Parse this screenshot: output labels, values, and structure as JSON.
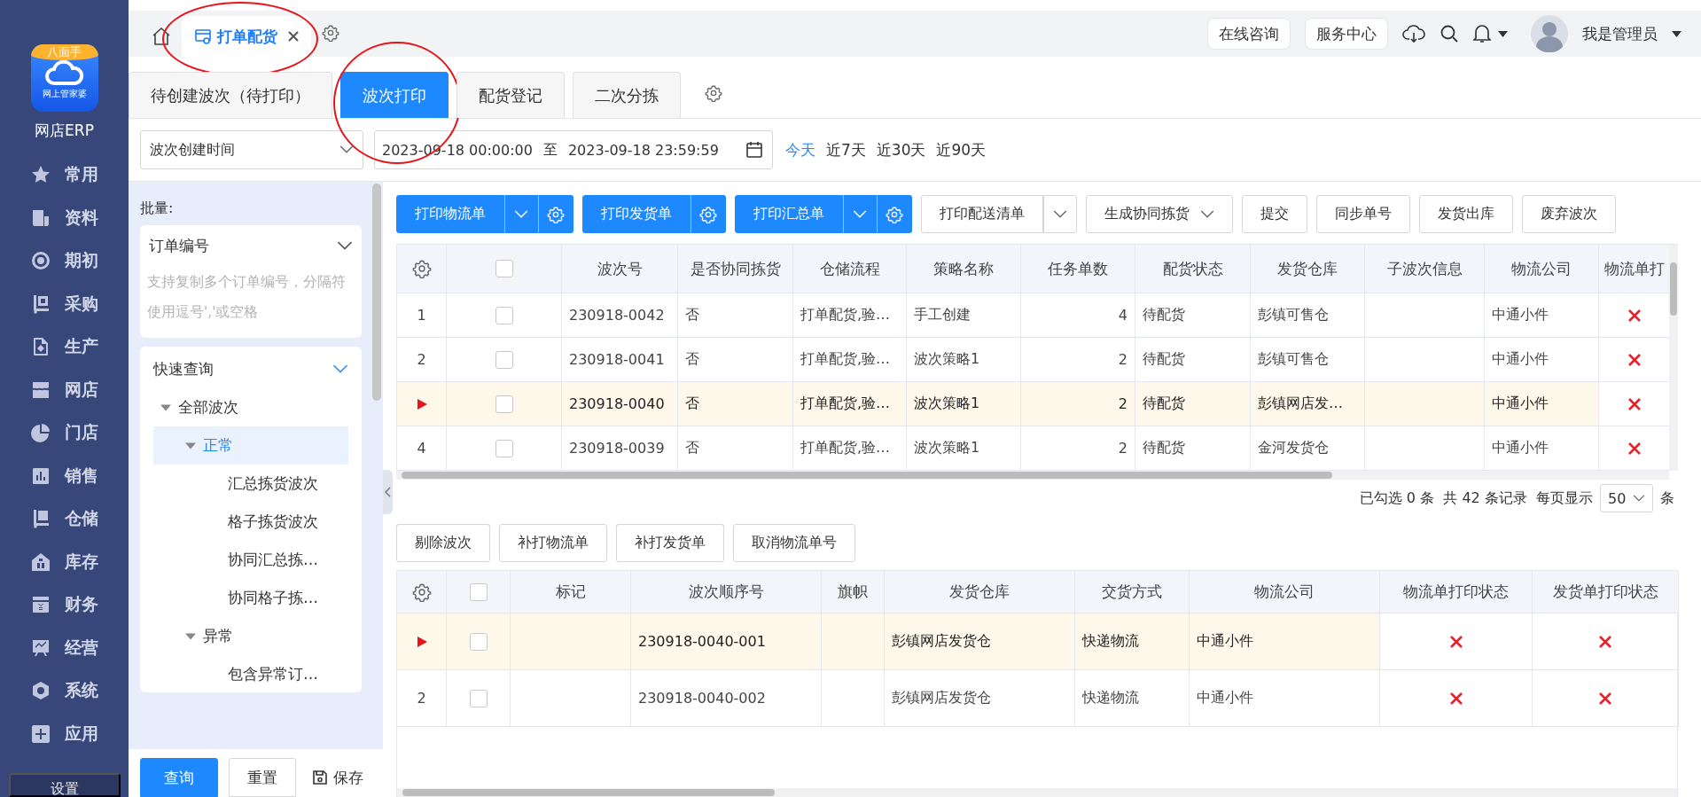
{
  "sidebar": {
    "logo_badge": "八面手",
    "logo_caption": "网上管家婆",
    "brand": "网店ERP",
    "items": [
      "常用",
      "资料",
      "期初",
      "采购",
      "生产",
      "网店",
      "门店",
      "销售",
      "仓储",
      "库存",
      "财务",
      "经营",
      "系统",
      "应用"
    ],
    "footer": "设置"
  },
  "page_tabs": [
    {
      "label": "打单配货",
      "selected": true,
      "circled": true
    }
  ],
  "header_links": [
    "在线咨询",
    "服务中心"
  ],
  "user": {
    "name": "我是管理员"
  },
  "sub_tabs": [
    {
      "label": "待创建波次（待打印）",
      "selected": false,
      "circled": false
    },
    {
      "label": "波次打印",
      "selected": true,
      "circled": true
    },
    {
      "label": "配货登记",
      "selected": false,
      "circled": false
    },
    {
      "label": "二次分拣",
      "selected": false,
      "circled": false
    }
  ],
  "filter": {
    "date_type": "波次创建时间",
    "start": "2023-09-18 00:00:00",
    "separator": "至",
    "end": "2023-09-18 23:59:59",
    "ranges": [
      {
        "label": "今天",
        "selected": true
      },
      {
        "label": "近7天",
        "selected": false
      },
      {
        "label": "近30天",
        "selected": false
      },
      {
        "label": "近90天",
        "selected": false
      }
    ]
  },
  "left_panel": {
    "batch_label": "批量:",
    "batch_type": "订单编号",
    "batch_placeholder": "支持复制多个订单编号，分隔符使用逗号','或空格",
    "quick_title": "快速查询",
    "tree": [
      {
        "label": "全部波次",
        "expanded": true,
        "selected": false,
        "children": [
          {
            "label": "正常",
            "expanded": true,
            "selected": true,
            "children": [
              {
                "label": "汇总拣货波次",
                "selected": false
              },
              {
                "label": "格子拣货波次",
                "selected": false
              },
              {
                "label": "协同汇总拣…",
                "selected": false
              },
              {
                "label": "协同格子拣…",
                "selected": false
              }
            ]
          },
          {
            "label": "异常",
            "expanded": true,
            "selected": false,
            "children": [
              {
                "label": "包含异常订…",
                "selected": false
              }
            ]
          }
        ]
      }
    ],
    "actions": [
      {
        "label": "查询",
        "kind": "primary"
      },
      {
        "label": "重置",
        "kind": "default"
      },
      {
        "label": "保存",
        "kind": "save"
      }
    ]
  },
  "wave_toolbar": [
    {
      "label": "打印物流单",
      "kind": "primary",
      "dropdown": true,
      "settings": true
    },
    {
      "label": "打印发货单",
      "kind": "primary",
      "dropdown": false,
      "settings": true
    },
    {
      "label": "打印汇总单",
      "kind": "primary",
      "dropdown": true,
      "settings": true
    },
    {
      "label": "打印配送清单",
      "kind": "default",
      "dropdown": true,
      "settings": false
    },
    {
      "label": "生成协同拣货",
      "kind": "select"
    },
    {
      "label": "提交",
      "kind": "default",
      "dropdown": false,
      "settings": false
    },
    {
      "label": "同步单号",
      "kind": "default",
      "dropdown": false,
      "settings": false
    },
    {
      "label": "发货出库",
      "kind": "default",
      "dropdown": false,
      "settings": false
    },
    {
      "label": "废弃波次",
      "kind": "default",
      "dropdown": false,
      "settings": false
    }
  ],
  "wave_table": {
    "all_checked": false,
    "columns": [
      "波次号",
      "是否协同拣货",
      "仓储流程",
      "策略名称",
      "任务单数",
      "配货状态",
      "发货仓库",
      "子波次信息",
      "物流公司",
      "物流单打"
    ],
    "rows": [
      {
        "index": "1",
        "current": false,
        "checked": false,
        "wave_no": "230918-0042",
        "collab": "否",
        "flow": "打单配货,验…",
        "strategy": "手工创建",
        "task_count": "4",
        "status": "待配货",
        "warehouse": "彭镇可售仓",
        "carrier": "中通小件",
        "logistics_printed": false
      },
      {
        "index": "2",
        "current": false,
        "checked": false,
        "wave_no": "230918-0041",
        "collab": "否",
        "flow": "打单配货,验…",
        "strategy": "波次策略1",
        "task_count": "2",
        "status": "待配货",
        "warehouse": "彭镇可售仓",
        "carrier": "中通小件",
        "logistics_printed": false
      },
      {
        "current": true,
        "checked": false,
        "wave_no": "230918-0040",
        "collab": "否",
        "flow": "打单配货,验…",
        "strategy": "波次策略1",
        "task_count": "2",
        "status": "待配货",
        "warehouse": "彭镇网店发…",
        "carrier": "中通小件",
        "logistics_printed": false
      },
      {
        "index": "4",
        "current": false,
        "checked": false,
        "wave_no": "230918-0039",
        "collab": "否",
        "flow": "打单配货,验…",
        "strategy": "波次策略1",
        "task_count": "2",
        "status": "待配货",
        "warehouse": "金河发货仓",
        "carrier": "中通小件",
        "logistics_printed": false
      }
    ]
  },
  "pagination": {
    "summary": "已勾选 0 条  共 42 条记录  每页显示",
    "page_size": "50",
    "unit": "条"
  },
  "detail_toolbar": [
    "剔除波次",
    "补打物流单",
    "补打发货单",
    "取消物流单号"
  ],
  "detail_table": {
    "all_checked": false,
    "columns": [
      "标记",
      "波次顺序号",
      "旗帜",
      "发货仓库",
      "交货方式",
      "物流公司",
      "物流单打印状态",
      "发货单打印状态"
    ],
    "rows": [
      {
        "current": true,
        "checked": false,
        "seq": "230918-0040-001",
        "warehouse": "彭镇网店发货仓",
        "delivery": "快递物流",
        "carrier": "中通小件",
        "logistics_printed": false,
        "invoice_printed": false
      },
      {
        "index": "2",
        "current": false,
        "checked": false,
        "seq": "230918-0040-002",
        "warehouse": "彭镇网店发货仓",
        "delivery": "快递物流",
        "carrier": "中通小件",
        "logistics_printed": false,
        "invoice_printed": false
      }
    ]
  }
}
